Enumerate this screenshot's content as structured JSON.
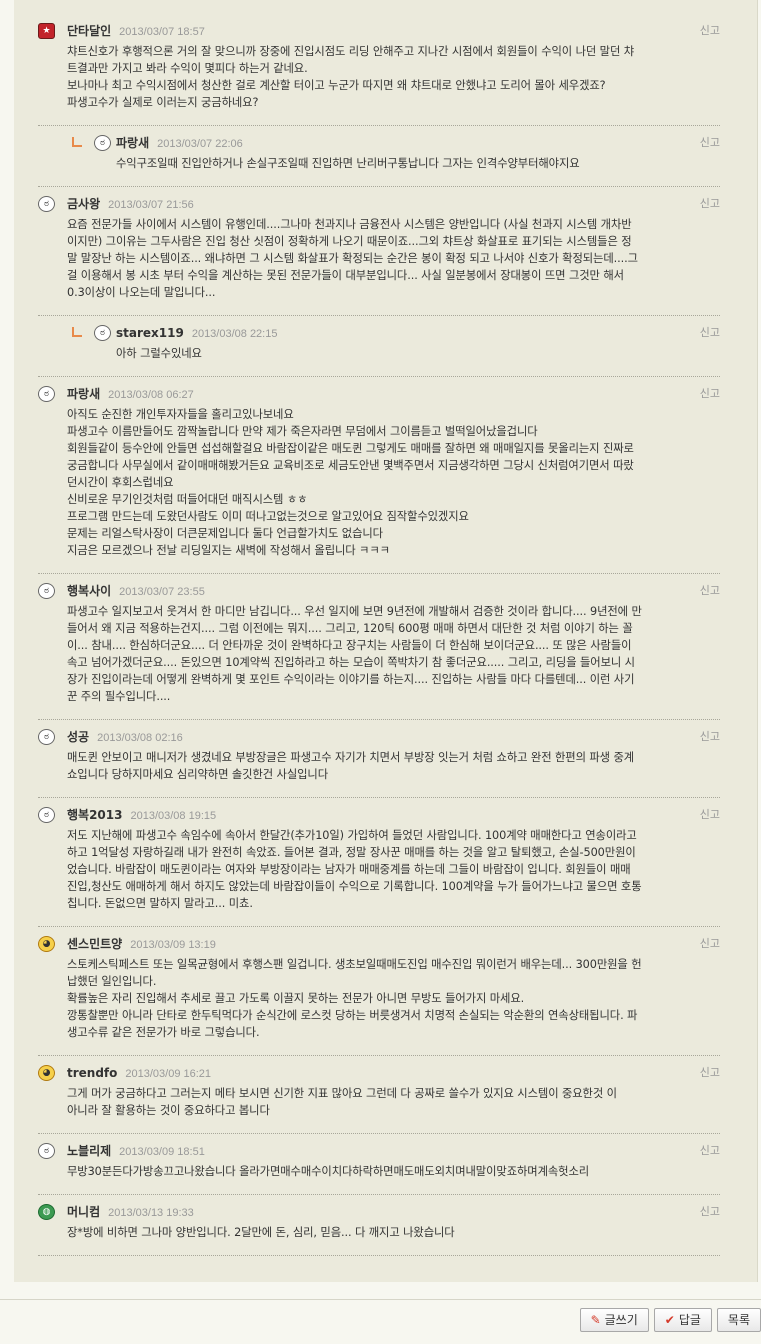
{
  "report_label": "신고",
  "comments": [
    {
      "name": "단타달인",
      "date": "2013/03/07 18:57",
      "avatar": "red",
      "reply": false,
      "text": "챠트신호가 후행적으론 거의 잘 맞으니까 장중에 진입시점도 리딩 안해주고 지나간 시점에서 회원들이 수익이 나던 말던 챠\n트결과만 가지고 봐라 수익이 몇피다 하는거 같네요.\n보나마나 최고 수익시점에서 청산한 걸로 계산할 터이고 누군가 따지면 왜 챠트대로 안했냐고 도리어 몰아 세우겠죠?\n파생고수가 실제로 이러는지 궁금하네요?"
    },
    {
      "name": "파랑새",
      "date": "2013/03/07 22:06",
      "avatar": "face",
      "reply": true,
      "text": "수익구조일때 진입안하거나 손실구조일때 진입하면 난리버구통납니다 그자는 인격수양부터해야지요"
    },
    {
      "name": "금사왕",
      "date": "2013/03/07 21:56",
      "avatar": "face",
      "reply": false,
      "text": "요즘 전문가들 사이에서 시스템이 유행인데....그나마 천과지나 금융전사 시스템은 양반입니다 (사실 천과지 시스템 개차반\n이지만) 그이유는 그두사람은 진입 청산 싯점이 정확하게 나오기 때문이죠...그외 챠트상 화살표로 표기되는 시스템들은 정\n말 말장난 하는 시스템이죠... 왜냐하면 그 시스템 화살표가 확정되는 순간은 봉이 확정 되고 나서야 신호가 확정되는데....그\n걸 이용해서 봉 시초 부터 수익을 계산하는 못된 전문가들이 대부분입니다... 사실 일분봉에서 장대봉이 뜨면 그것만 해서\n0.3이상이 나오는데 말입니다..."
    },
    {
      "name": "starex119",
      "date": "2013/03/08 22:15",
      "avatar": "face",
      "reply": true,
      "text": "아하 그럴수있네요"
    },
    {
      "name": "파랑새",
      "date": "2013/03/08 06:27",
      "avatar": "face",
      "reply": false,
      "text": "아직도 순진한 개인투자자들을 홀리고있나보네요\n파생고수 이름만들어도 깜짝놀랍니다 만약 제가 죽은자라면 무덤에서 그이름듣고 벌떡일어났을겁니다\n회원들같이 등수안에 안들면 섭섭해할걸요 바람잡이같은 매도퀸 그렇게도 매매를 잘하면 왜 매매일지를 못올리는지 진짜로\n궁금합니다 사무실에서 같이매매해봤거든요 교육비조로 세금도안낸 몇백주면서 지금생각하면 그당시 신처럼여기면서 따랐\n던시간이 후회스럽네요\n신비로운 무기인것처럼 떠들어대던 매직시스템 ㅎㅎ\n프로그램 만드는데 도왔던사람도 이미 떠나고없는것으로 알고있어요 짐작할수있겠지요\n문제는 리얼스탁사장이 더큰문제입니다 둘다 언급할가치도 없습니다\n지금은 모르겠으나 전날 리딩일지는 새벽에 작성해서 올립니다 ㅋㅋㅋ"
    },
    {
      "name": "행복사이",
      "date": "2013/03/07 23:55",
      "avatar": "face",
      "reply": false,
      "text": "파생고수 일지보고서 웃겨서 한 마디만 남깁니다... 우선 일지에 보면 9년전에 개발해서 검증한 것이라 합니다.... 9년전에 만\n들어서 왜 지금 적용하는건지.... 그럼 이전에는 뭐지.... 그리고, 120틱 600평 매매 하면서 대단한 것 처럼 이야기 하는 꼴\n이... 참내.... 한심하더군요.... 더 안타까운 것이 완벽하다고 장구치는 사람들이 더 한심해 보이더군요.... 또 많은 사람들이\n속고 넘어가겠더군요.... 돈있으면 10계약씩 진입하라고 하는 모습이 쪽박차기 참 좋더군요..... 그리고, 리딩을 들어보니 시\n장가 진입이라는데 어떻게 완벽하게 몇 포인트 수익이라는 이야기를 하는지.... 진입하는 사람들 마다 다를텐데... 이런 사기\n꾼 주의 필수입니다...."
    },
    {
      "name": "성공",
      "date": "2013/03/08 02:16",
      "avatar": "face",
      "reply": false,
      "text": "매도퀸 안보이고 매니저가 생겼네요 부방장글은 파생고수 자기가 치면서 부방장 잇는거 처럼 쇼하고 완전 한편의 파생 중계\n쇼입니다 당하지마세요 심리약하면 솔깃한건 사실입니다"
    },
    {
      "name": "행복2013",
      "date": "2013/03/08 19:15",
      "avatar": "face",
      "reply": false,
      "text": "저도 지난해에 파생고수 속임수에 속아서 한달간(추가10일) 가입하여 들었던 사람입니다. 100계약 매매한다고 연송이라고\n하고 1억달성 자랑하길래 내가 완전히 속았죠. 들어본 결과, 정말 장사꾼 매매를 하는 것을 알고 탈퇴했고, 손실-500만원이\n었습니다. 바람잡이 매도퀸이라는 여자와 부방장이라는 남자가 매매중계를 하는데 그들이 바람잡이 입니다. 회원들이 매매\n진입,청산도 애매하게 해서 하지도 않았는데 바람잡이들이 수익으로 기록합니다. 100계약을 누가 들어가느냐고 물으면 호통\n칩니다. 돈없으면 말하지 말라고... 미쵸."
    },
    {
      "name": "센스민트양",
      "date": "2013/03/09 13:19",
      "avatar": "yellow",
      "reply": false,
      "text": "스토케스틱페스트 또는 일목균형에서 후행스팬 일겁니다. 생초보일때매도진입 매수진입 뭐이런거 배우는데... 300만원을 헌\n납했던 일인입니다.\n확률높은 자리 진입해서 추세로 끌고 가도록 이끌지 못하는 전문가 아니면 무방도 들어가지 마세요.\n깡통찰뿐만 아니라 단타로 한두틱먹다가 순식간에 로스컷 당하는 버릇생겨서 치명적 손실되는 악순환의 연속상태됩니다. 파\n생고수류 같은 전문가가 바로 그렇습니다."
    },
    {
      "name": "trendfo",
      "date": "2013/03/09 16:21",
      "avatar": "yellow",
      "reply": false,
      "text": "그게 머가 궁금하다고 그러는지 메타 보시면 신기한 지표 많아요 그런데 다 공짜로 쓸수가 있지요 시스템이 중요한것 이\n아니라 잘 활용하는 것이 중요하다고 봅니다"
    },
    {
      "name": "노블리제",
      "date": "2013/03/09 18:51",
      "avatar": "face",
      "reply": false,
      "text": "무방30분든다가방송끄고나왔습니다 올라가면매수매수이치다하락하면매도매도외치며내말이맞죠하며계속헛소리"
    },
    {
      "name": "머니컴",
      "date": "2013/03/13 19:33",
      "avatar": "globe",
      "reply": false,
      "text": "장*방에 비하면 그나마 양반입니다. 2달만에 돈, 심리, 믿음... 다 깨지고 나왔습니다"
    }
  ],
  "buttons": {
    "write": "글쓰기",
    "reply": "답글",
    "list": "목록"
  }
}
